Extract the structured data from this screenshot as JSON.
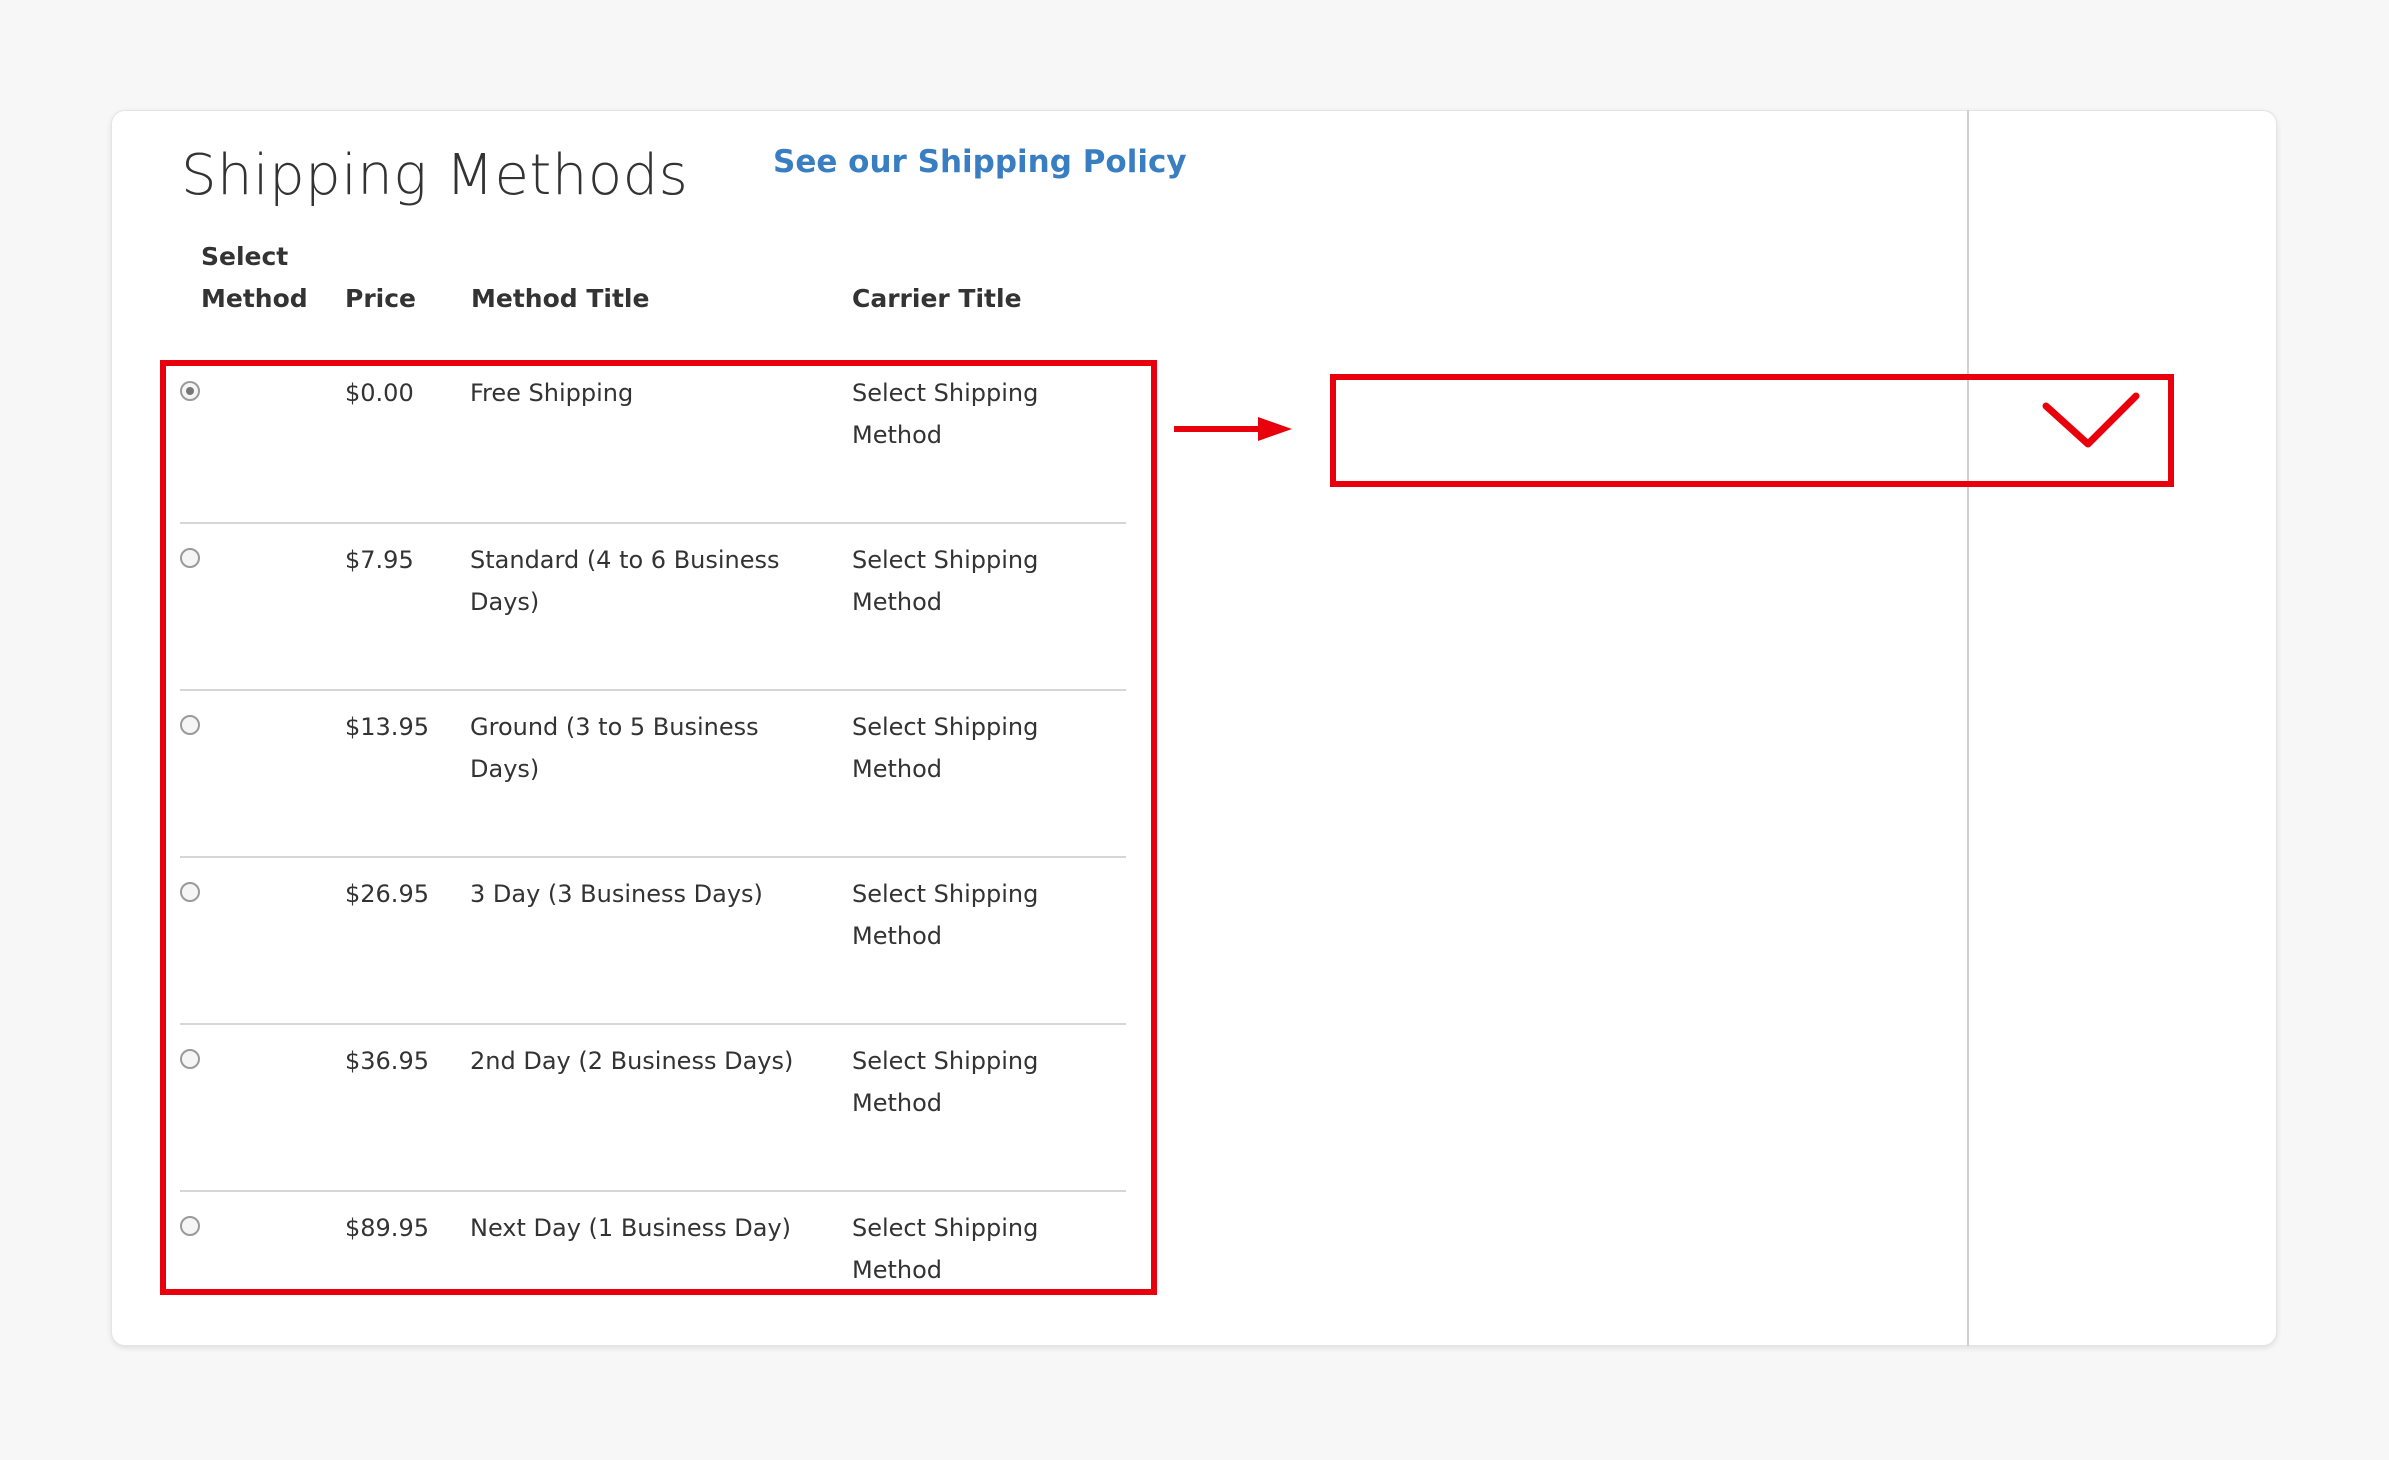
{
  "header": {
    "title": "Shipping Methods",
    "policy_link": "See our Shipping Policy"
  },
  "table": {
    "columns": {
      "select_line1": "Select",
      "select_line2": "Method",
      "price": "Price",
      "method_title": "Method Title",
      "carrier_title": "Carrier Title"
    },
    "rows": [
      {
        "selected": true,
        "price": "$0.00",
        "method": "Free Shipping",
        "carrier": "Select Shipping Method"
      },
      {
        "selected": false,
        "price": "$7.95",
        "method": "Standard (4 to 6 Business Days)",
        "carrier": "Select Shipping Method"
      },
      {
        "selected": false,
        "price": "$13.95",
        "method": "Ground (3 to 5 Business Days)",
        "carrier": "Select Shipping Method"
      },
      {
        "selected": false,
        "price": "$26.95",
        "method": "3 Day (3 Business Days)",
        "carrier": "Select Shipping Method"
      },
      {
        "selected": false,
        "price": "$36.95",
        "method": "2nd Day (2 Business Days)",
        "carrier": "Select Shipping Method"
      },
      {
        "selected": false,
        "price": "$89.95",
        "method": "Next Day (1 Business Day)",
        "carrier": "Select Shipping Method"
      }
    ]
  },
  "annotation": {
    "color": "#e8000d",
    "arrow_icon": "right-arrow-icon",
    "check_icon": "checkmark-icon"
  },
  "colors": {
    "link": "#3a7ec2",
    "text": "#333333",
    "background": "#f7f7f7",
    "card": "#ffffff"
  }
}
